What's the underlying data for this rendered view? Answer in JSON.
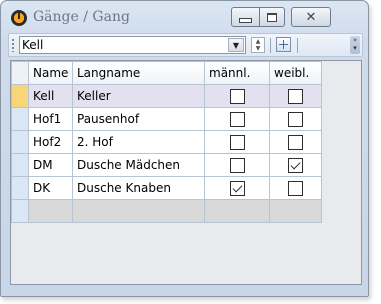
{
  "window": {
    "title": "Gänge / Gang"
  },
  "toolbar": {
    "combo_value": "Kell"
  },
  "grid": {
    "columns": [
      "Name",
      "Langname",
      "männl.",
      "weibl."
    ],
    "rows": [
      {
        "name": "Kell",
        "langname": "Keller",
        "maennl": false,
        "weibl": false
      },
      {
        "name": "Hof1",
        "langname": "Pausenhof",
        "maennl": false,
        "weibl": false
      },
      {
        "name": "Hof2",
        "langname": "2. Hof",
        "maennl": false,
        "weibl": false
      },
      {
        "name": "DM",
        "langname": "Dusche Mädchen",
        "maennl": false,
        "weibl": true
      },
      {
        "name": "DK",
        "langname": "Dusche Knaben",
        "maennl": true,
        "weibl": false
      }
    ],
    "current_row": 0
  }
}
